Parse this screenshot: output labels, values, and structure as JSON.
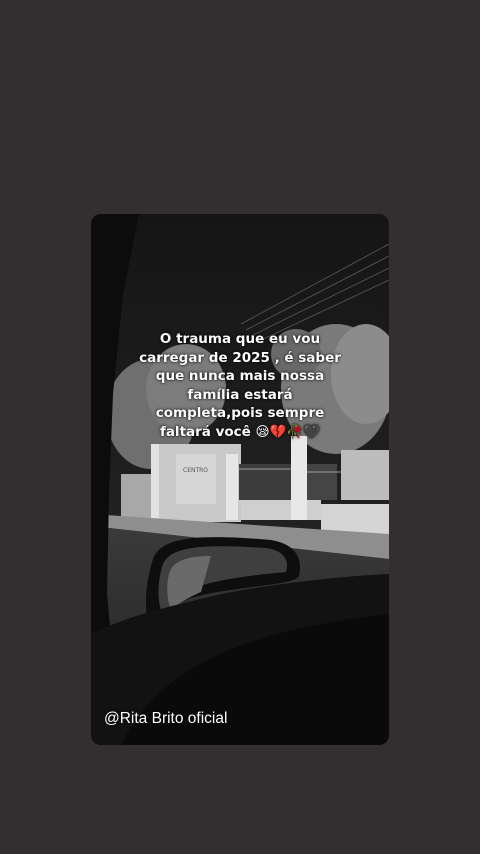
{
  "story": {
    "quote_lines": [
      "O trauma que eu vou",
      "carregar de 2025 , é saber",
      "que nunca mais nossa",
      "família estará",
      "completa,pois sempre",
      "faltará você 😪💔🥀🖤"
    ],
    "author_handle": "@Rita Brito oficial",
    "building_sign": "CENTRO"
  },
  "colors": {
    "page_background": "#332f30",
    "text": "#ffffff"
  }
}
